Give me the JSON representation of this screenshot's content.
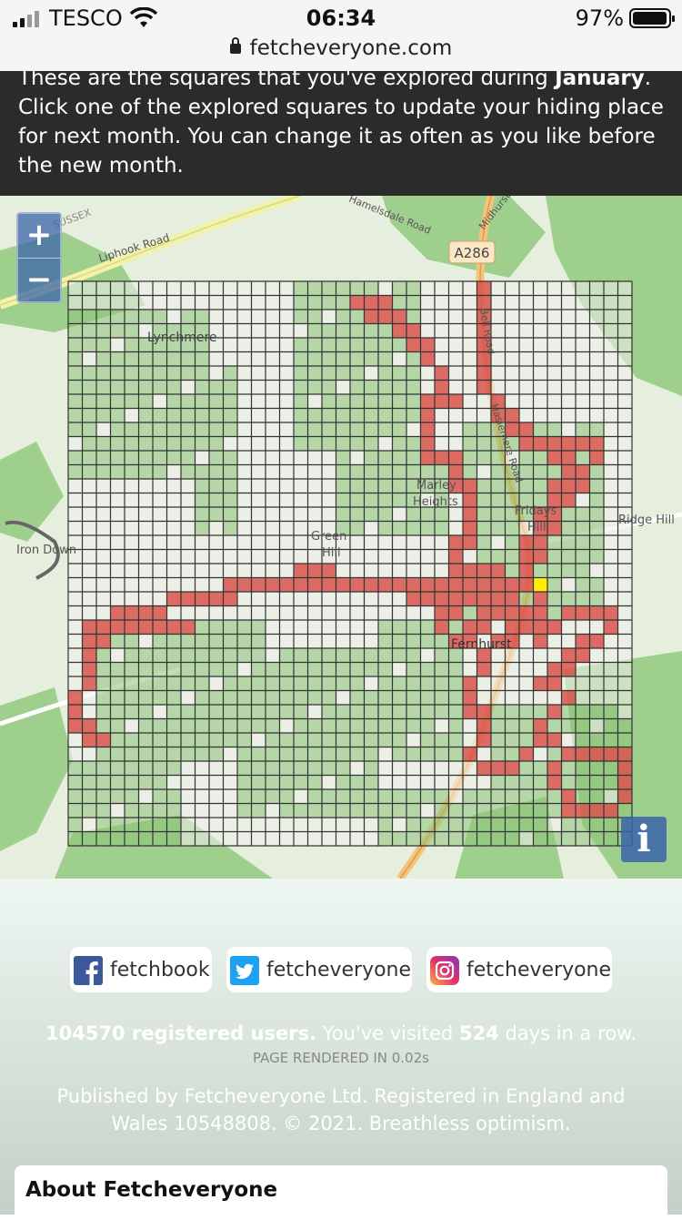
{
  "status_bar": {
    "carrier": "TESCO",
    "time": "06:34",
    "battery": "97%",
    "battery_level": 0.97,
    "url": "fetcheveryone.com"
  },
  "banner": {
    "text_before": "These are the squares that you've explored during ",
    "month": "January",
    "text_after": ". Click one of the explored squares to update your hiding place for next month. You can change it as often as you like before the new month."
  },
  "map": {
    "zoom_in": "+",
    "zoom_out": "−",
    "info": "i",
    "labels": {
      "lynchmere": "Lynchmere",
      "marley": "Marley",
      "heights": "Heights",
      "green": "Green",
      "hill": "Hill",
      "fridays": "Fridays",
      "fridays_hill": "Hill",
      "ridge_hill": "Ridge Hill",
      "iron_down": "Iron Down",
      "fernhurst": "Fernhurst",
      "a286": "A286",
      "liphook_road": "Liphook Road",
      "haslemere_road": "Haslemere Road",
      "hamelsdale_road": "Hamelsdale Road",
      "midhurst": "Midhurst",
      "bell_road": "Bell Road",
      "sussex": "SUSSEX"
    },
    "colors": {
      "explored": "#d9534f",
      "hiding_place": "#ffee00",
      "woodland": "#8cc47a",
      "grid": "#333333"
    }
  },
  "footer": {
    "social": {
      "facebook": "fetchbook",
      "twitter": "fetcheveryone",
      "instagram": "fetcheveryone"
    },
    "stats": {
      "users": "104570 registered users.",
      "visited_prefix": " You've visited ",
      "days": "524",
      "visited_suffix": " days in a row."
    },
    "rendered": "PAGE RENDERED IN 0.02s",
    "published": "Published by Fetcheveryone Ltd. Registered in England and Wales 10548808. © 2021. Breathless optimism.",
    "about_title": "About Fetcheveryone"
  }
}
